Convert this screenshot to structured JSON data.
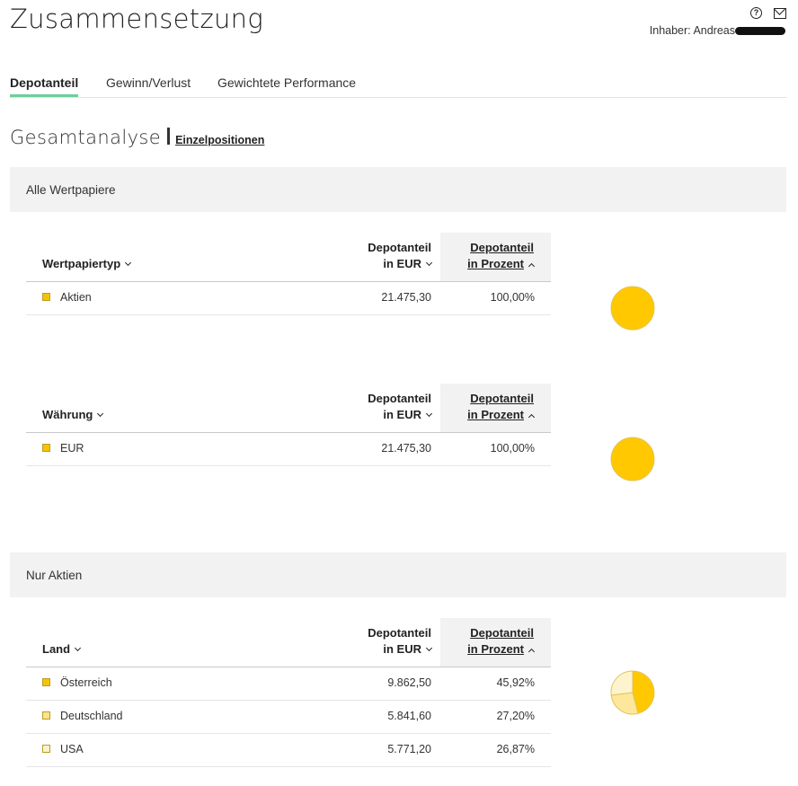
{
  "page": {
    "title": "Zusammensetzung",
    "owner_label": "Inhaber:",
    "owner_name": "Andreas"
  },
  "icons": {
    "help": "help-circle-icon",
    "mail": "mail-icon"
  },
  "tabs": [
    {
      "label": "Depotanteil",
      "active": true
    },
    {
      "label": "Gewinn/Verlust",
      "active": false
    },
    {
      "label": "Gewichtete Performance",
      "active": false
    }
  ],
  "analysis": {
    "title": "Gesamtanalyse",
    "link": "Einzelpositionen"
  },
  "bands": {
    "all": "Alle Wertpapiere",
    "shares": "Nur Aktien"
  },
  "header_common": {
    "amount_line1": "Depotanteil",
    "amount_line2": "in EUR",
    "pct_line1": "Depotanteil",
    "pct_line2": "in Prozent"
  },
  "tables": {
    "type": {
      "first_col": "Wertpapiertyp",
      "rows": [
        {
          "label": "Aktien",
          "amount": "21.475,30",
          "percent": "100,00%",
          "color": "#f5c400"
        }
      ]
    },
    "currency": {
      "first_col": "Währung",
      "rows": [
        {
          "label": "EUR",
          "amount": "21.475,30",
          "percent": "100,00%",
          "color": "#f5c400"
        }
      ]
    },
    "country": {
      "first_col": "Land",
      "rows": [
        {
          "label": "Österreich",
          "amount": "9.862,50",
          "percent": "45,92%",
          "color": "#f5c400"
        },
        {
          "label": "Deutschland",
          "amount": "5.841,60",
          "percent": "27,20%",
          "color": "#fbe48a"
        },
        {
          "label": "USA",
          "amount": "5.771,20",
          "percent": "26,87%",
          "color": "#fdf3c6"
        }
      ]
    }
  },
  "chart_data": [
    {
      "type": "pie",
      "values": [
        100.0
      ],
      "colors": [
        "#ffc800"
      ]
    },
    {
      "type": "pie",
      "values": [
        100.0
      ],
      "colors": [
        "#ffc800"
      ]
    },
    {
      "type": "pie",
      "values": [
        45.92,
        27.2,
        26.87
      ],
      "colors": [
        "#ffc800",
        "#fde79a",
        "#fdf4cf"
      ]
    }
  ]
}
